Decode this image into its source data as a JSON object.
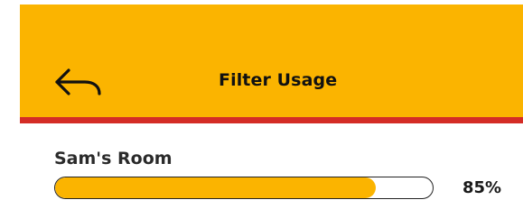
{
  "header": {
    "title": "Filter Usage",
    "back_icon": "back-arrow-icon",
    "background_color": "#FBB400",
    "accent_color": "#D42C26"
  },
  "filters": [
    {
      "room": "Sam's Room",
      "usage_percent": 85,
      "usage_label": "85%",
      "bar_color": "#FBB400"
    }
  ]
}
